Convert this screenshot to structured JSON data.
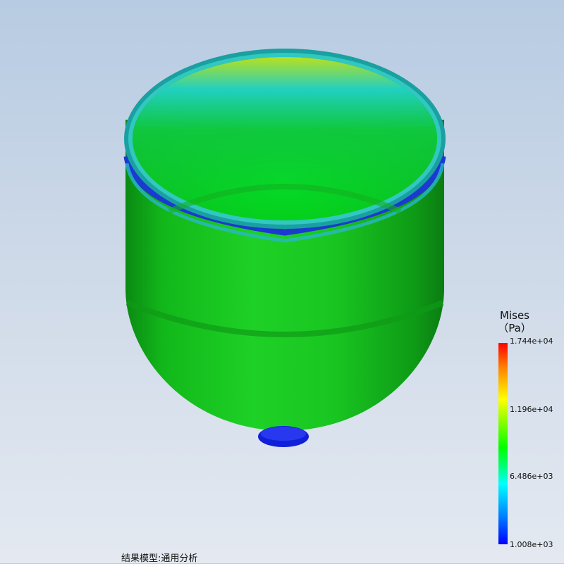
{
  "legend": {
    "quantity": "Mises",
    "unit": "（Pa）",
    "ticks": [
      "1.744e+04",
      "1.196e+04",
      "6.486e+03",
      "1.008e+03"
    ]
  },
  "footer": {
    "label": "结果模型:通用分析"
  },
  "colors": {
    "max": "#ff0000",
    "mid": "#00ff00",
    "low": "#00ffff",
    "min": "#0000ff"
  }
}
